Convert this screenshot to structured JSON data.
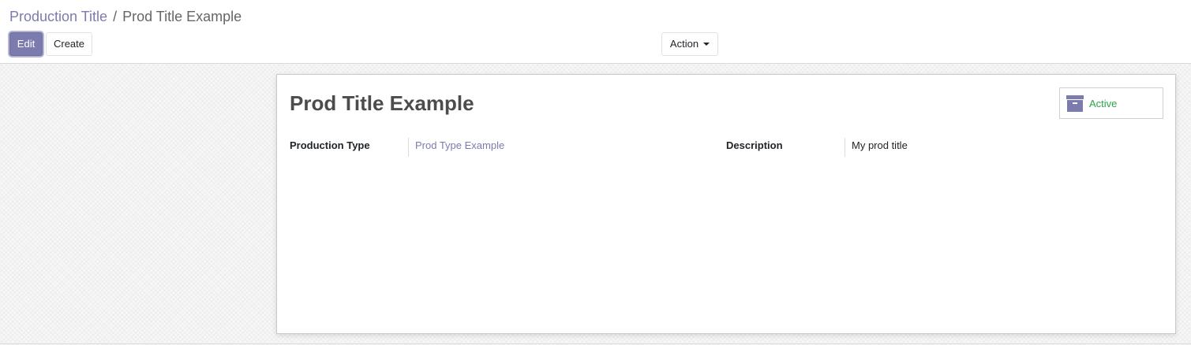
{
  "breadcrumb": {
    "parent": "Production Title",
    "separator": "/",
    "current": "Prod Title Example"
  },
  "toolbar": {
    "edit_label": "Edit",
    "create_label": "Create",
    "action_label": "Action"
  },
  "record": {
    "title": "Prod Title Example",
    "status_button": {
      "label": "Active",
      "icon": "archive-icon",
      "color": "#28a745"
    },
    "fields": [
      {
        "label": "Production Type",
        "value": "Prod Type Example",
        "is_link": true
      },
      {
        "label": "Description",
        "value": "My prod title",
        "is_link": false
      }
    ]
  },
  "colors": {
    "accent": "#7c7bad",
    "status_active": "#28a745"
  }
}
